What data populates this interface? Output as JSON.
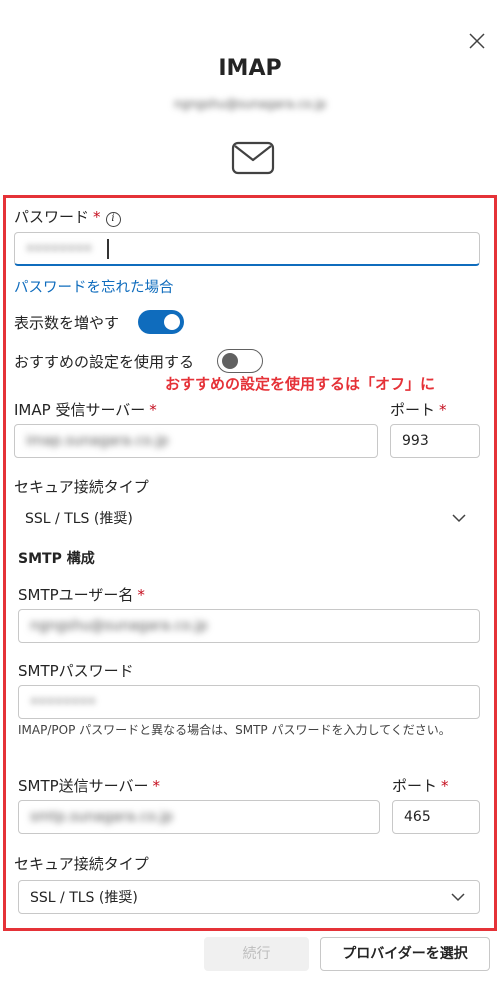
{
  "header": {
    "title": "IMAP",
    "email": "ngngshu@sunagara.co.jp"
  },
  "password": {
    "label": "パスワード",
    "required": "*",
    "info_glyph": "i",
    "value": "••••••••",
    "forgot_link": "パスワードを忘れた場合"
  },
  "show_more": {
    "label": "表示数を増やす",
    "on": true
  },
  "recommended": {
    "label": "おすすめの設定を使用する",
    "on": false
  },
  "annotation": "おすすめの設定を使用するは「オフ」に",
  "imap": {
    "server_label": "IMAP 受信サーバー",
    "server_value": "imap.sunagara.co.jp",
    "port_label": "ポート",
    "port_value": "993",
    "security_label": "セキュア接続タイプ",
    "security_value": "SSL / TLS (推奨)"
  },
  "smtp": {
    "section_title": "SMTP 構成",
    "user_label": "SMTPユーザー名",
    "user_value": "ngngshu@sunagara.co.jp",
    "password_label": "SMTPパスワード",
    "password_value": "••••••••",
    "hint": "IMAP/POP パスワードと異なる場合は、SMTP パスワードを入力してください。",
    "server_label": "SMTP送信サーバー",
    "server_value": "smtp.sunagara.co.jp",
    "port_label": "ポート",
    "port_value": "465",
    "security_label": "セキュア接続タイプ",
    "security_value": "SSL / TLS (推奨)"
  },
  "required_mark": "*",
  "footer": {
    "continue_label": "続行",
    "choose_provider_label": "プロバイダーを選択"
  },
  "colors": {
    "accent": "#0f6cbd",
    "highlight_frame": "#e53238",
    "required": "#c50f1f"
  }
}
